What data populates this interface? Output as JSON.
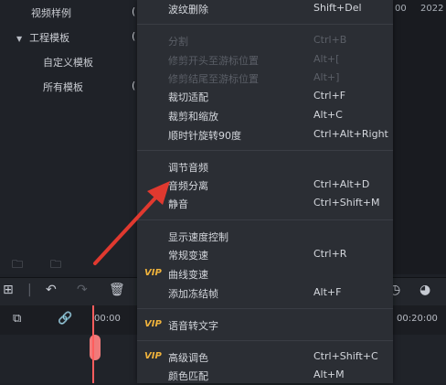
{
  "sidebar": {
    "items": [
      {
        "label": "视频样例",
        "suffix": "("
      },
      {
        "label": "工程模板",
        "suffix": "("
      },
      {
        "label": "自定义模板",
        "suffix": ""
      },
      {
        "label": "所有模板",
        "suffix": "("
      }
    ]
  },
  "right_strip": {
    "text1": "00",
    "text2": "2022"
  },
  "timeline": {
    "ruler_left": "00:00",
    "ruler_right": "00:20:00"
  },
  "menu": {
    "vip_badge": "VIP",
    "items": [
      {
        "label": "波纹删除",
        "shortcut": "Shift+Del",
        "enabled": true,
        "vip": false
      },
      {
        "label": "分割",
        "shortcut": "Ctrl+B",
        "enabled": false,
        "vip": false
      },
      {
        "label": "修剪开头至游标位置",
        "shortcut": "Alt+[",
        "enabled": false,
        "vip": false
      },
      {
        "label": "修剪结尾至游标位置",
        "shortcut": "Alt+]",
        "enabled": false,
        "vip": false
      },
      {
        "label": "裁切适配",
        "shortcut": "Ctrl+F",
        "enabled": true,
        "vip": false
      },
      {
        "label": "裁剪和缩放",
        "shortcut": "Alt+C",
        "enabled": true,
        "vip": false
      },
      {
        "label": "顺时针旋转90度",
        "shortcut": "Ctrl+Alt+Right",
        "enabled": true,
        "vip": false
      },
      {
        "label": "调节音频",
        "shortcut": "",
        "enabled": true,
        "vip": false
      },
      {
        "label": "音频分离",
        "shortcut": "Ctrl+Alt+D",
        "enabled": true,
        "vip": false
      },
      {
        "label": "静音",
        "shortcut": "Ctrl+Shift+M",
        "enabled": true,
        "vip": false
      },
      {
        "label": "显示速度控制",
        "shortcut": "",
        "enabled": true,
        "vip": false
      },
      {
        "label": "常规变速",
        "shortcut": "Ctrl+R",
        "enabled": true,
        "vip": false
      },
      {
        "label": "曲线变速",
        "shortcut": "",
        "enabled": true,
        "vip": true
      },
      {
        "label": "添加冻结帧",
        "shortcut": "Alt+F",
        "enabled": true,
        "vip": false
      },
      {
        "label": "语音转文字",
        "shortcut": "",
        "enabled": true,
        "vip": true
      },
      {
        "label": "高级调色",
        "shortcut": "Ctrl+Shift+C",
        "enabled": true,
        "vip": true
      },
      {
        "label": "颜色匹配",
        "shortcut": "Alt+M",
        "enabled": true,
        "vip": false
      }
    ]
  },
  "colors": {
    "annotation_arrow": "#e0392f",
    "vip": "#f0b33c",
    "playhead": "#ff5d5d"
  }
}
